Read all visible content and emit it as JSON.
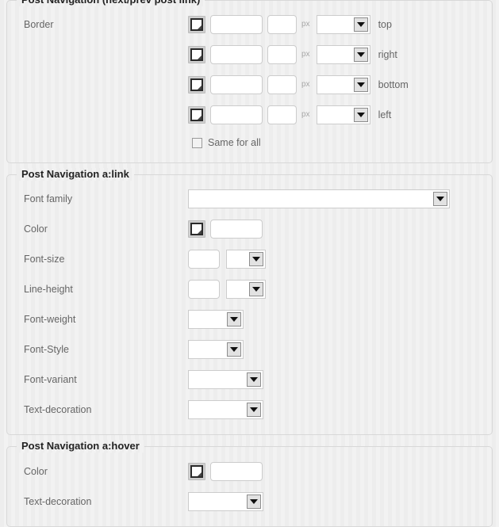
{
  "panels": [
    {
      "id": "post-navigation",
      "legend": "Post Navigation (next/prev post link)",
      "border_row_label": "Border",
      "unit_label": "px",
      "sides": [
        {
          "name": "top",
          "color_value": "",
          "width_value": "",
          "style_value": ""
        },
        {
          "name": "right",
          "color_value": "",
          "width_value": "",
          "style_value": ""
        },
        {
          "name": "bottom",
          "color_value": "",
          "width_value": "",
          "style_value": ""
        },
        {
          "name": "left",
          "color_value": "",
          "width_value": "",
          "style_value": ""
        }
      ],
      "same_for_all_label": "Same for all",
      "same_for_all_checked": false
    },
    {
      "id": "post-navigation-alink",
      "legend": "Post Navigation a:link",
      "rows": {
        "font_family_label": "Font family",
        "font_family_value": "",
        "color_label": "Color",
        "color_value": "",
        "font_size_label": "Font-size",
        "font_size_value": "",
        "font_size_unit": "",
        "line_height_label": "Line-height",
        "line_height_value": "",
        "line_height_unit": "",
        "font_weight_label": "Font-weight",
        "font_weight_value": "",
        "font_style_label": "Font-Style",
        "font_style_value": "",
        "font_variant_label": "Font-variant",
        "font_variant_value": "",
        "text_decoration_label": "Text-decoration",
        "text_decoration_value": ""
      }
    },
    {
      "id": "post-navigation-ahover",
      "legend": "Post Navigation a:hover",
      "rows": {
        "color_label": "Color",
        "color_value": "",
        "text_decoration_label": "Text-decoration",
        "text_decoration_value": ""
      }
    }
  ],
  "icons": {
    "color_swatch": "color-swatch-icon",
    "dropdown_arrow": "chevron-down-icon",
    "checkbox": "checkbox-icon"
  },
  "colors": {
    "page_background": "#eeeeee",
    "stripe_light": "#f2f2f2",
    "stripe_dark": "#ededed",
    "panel_border": "#d8d8d8",
    "legend_text": "#222222",
    "label_text": "#666666",
    "input_border": "#cccccc",
    "input_background": "#ffffff",
    "arrow_button_background": "#e2e2e2",
    "arrow_glyph": "#111111",
    "unit_text": "#a8a8a8"
  }
}
